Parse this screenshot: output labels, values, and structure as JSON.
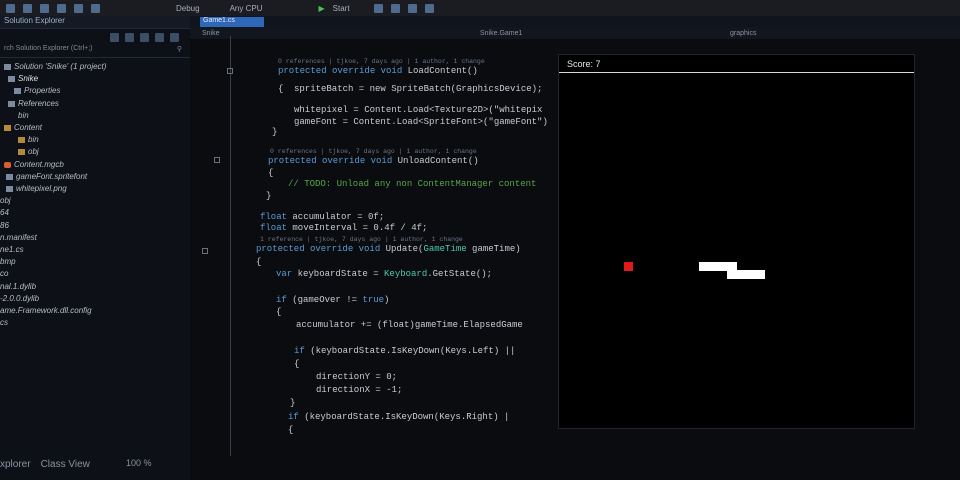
{
  "toolbar": {
    "config": "Debug",
    "platform": "Any CPU",
    "start_label": "Start"
  },
  "explorer": {
    "title": "Solution Explorer",
    "search_placeholder": "rch Solution Explorer (Ctrl+;)",
    "items": [
      "Solution 'Snike' (1 project)",
      "Snike",
      "Properties",
      "References",
      "bin",
      "Content",
      "bin",
      "obj",
      "Content.mgcb",
      "gameFont.spritefont",
      "whitepixel.png",
      "obj",
      "64",
      "86",
      "n.manifest",
      "ne1.cs",
      "bmp",
      "co",
      "nal.1.dylib",
      "-2.0.0.dylib",
      "ame.Framework.dll.config",
      "cs"
    ],
    "bottom_tabs": [
      "xplorer",
      "Class View"
    ]
  },
  "editor": {
    "tab": "Game1.cs",
    "nav_project": "Snike",
    "nav_class": "Snike.Game1",
    "nav_member": "graphics",
    "zoom": "100 %"
  },
  "code": {
    "ref1": "0 references | tjkoe, 7 days ago | 1 author, 1 change",
    "l_loadcontent": "protected override void LoadContent()",
    "l_brace1": "{",
    "l_spritebatch": "spriteBatch = new SpriteBatch(GraphicsDevice);",
    "l_whitepixel": "whitepixel = Content.Load<Texture2D>(\"whitepix",
    "l_gamefont": "gameFont = Content.Load<SpriteFont>(\"gameFont\")",
    "l_brace2": "}",
    "ref2": "0 references | tjkoe, 7 days ago | 1 author, 1 change",
    "l_unload": "protected override void UnloadContent()",
    "l_brace3": "{",
    "l_todo": "// TODO: Unload any non ContentManager content",
    "l_brace4": "}",
    "l_accum": "float accumulator = 0f;",
    "l_move": "float moveInterval = 0.4f / 4f;",
    "ref3": "1 reference | tjkoe, 7 days ago | 1 author, 1 change",
    "l_update": "protected override void Update(GameTime gameTime)",
    "l_brace5": "{",
    "l_kstate": "var keyboardState = Keyboard.GetState();",
    "l_if1": "if (gameOver != true)",
    "l_brace6": "{",
    "l_accadd": "accumulator += (float)gameTime.ElapsedGame",
    "l_if2": "if (keyboardState.IsKeyDown(Keys.Left) ||",
    "l_brace7": "{",
    "l_diry": "directionY = 0;",
    "l_dirx": "directionX = -1;",
    "l_brace8": "}",
    "l_if3": "if (keyboardState.IsKeyDown(Keys.Right) |",
    "l_brace9": "{"
  },
  "game": {
    "score_label": "Score: 7"
  },
  "colors": {
    "food": "#e01919",
    "snake": "#ffffff",
    "game_bg": "#000000",
    "tab_accent": "#2f67b8"
  }
}
